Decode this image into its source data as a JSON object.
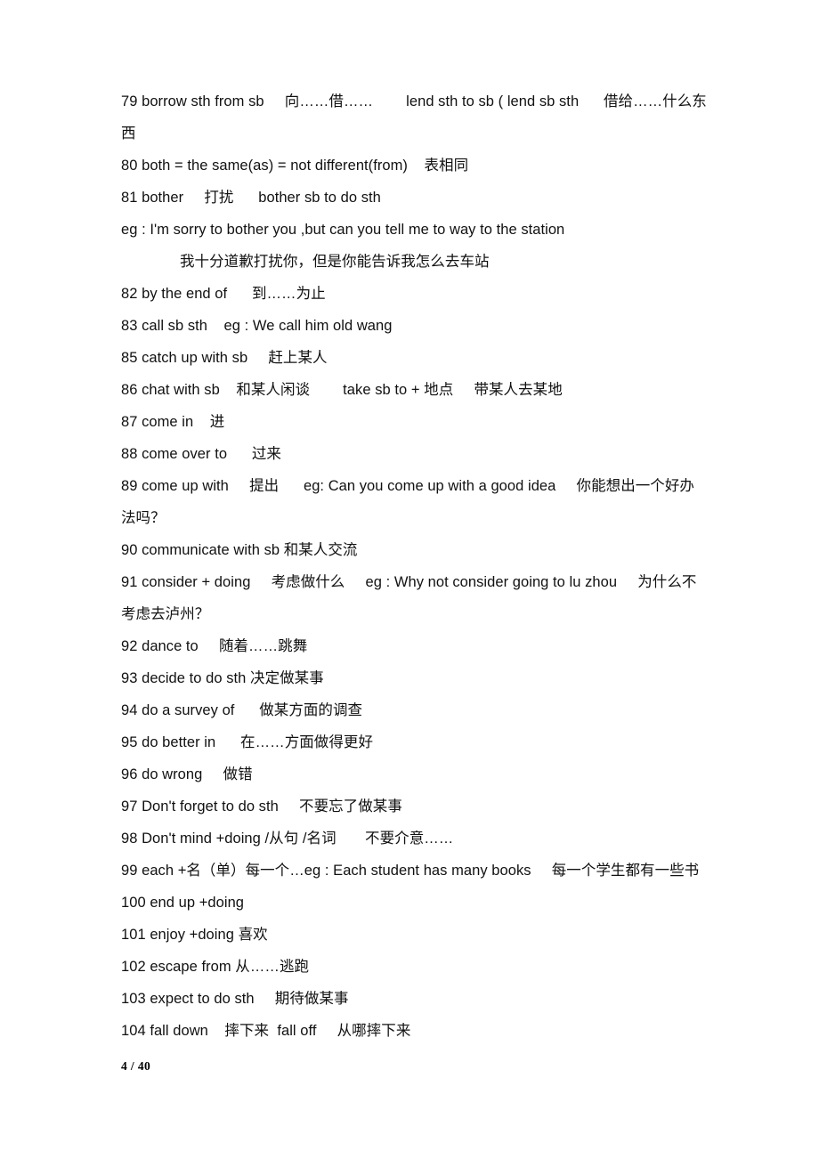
{
  "document": {
    "type": "study-notes",
    "language": "en-zh",
    "page_label": "4 / 40",
    "page_current": 4,
    "page_total": 40
  },
  "lines": [
    {
      "id": "l79",
      "number": "79",
      "text": "79 borrow sth from sb     向……借……        lend sth to sb ( lend sb sth      借给……什么东西",
      "wrap": true,
      "indent": false
    },
    {
      "id": "l80",
      "number": "80",
      "text": "80 both = the same(as) = not different(from)    表相同",
      "wrap": false,
      "indent": false
    },
    {
      "id": "l81",
      "number": "81",
      "text": "81 bother     打扰      bother sb to do sth",
      "wrap": false,
      "indent": false
    },
    {
      "id": "l81eg",
      "number": "",
      "text": "eg : I'm sorry to bother you ,but can you tell me to way to the station",
      "wrap": false,
      "indent": false
    },
    {
      "id": "l81eg-cn",
      "number": "",
      "text": "我十分道歉打扰你，但是你能告诉我怎么去车站",
      "wrap": false,
      "indent": true
    },
    {
      "id": "l82",
      "number": "82",
      "text": "82 by the end of      到……为止",
      "wrap": false,
      "indent": false
    },
    {
      "id": "l83",
      "number": "83",
      "text": "83 call sb sth    eg : We call him old wang",
      "wrap": false,
      "indent": false
    },
    {
      "id": "l85",
      "number": "85",
      "text": "85 catch up with sb     赶上某人",
      "wrap": false,
      "indent": false
    },
    {
      "id": "l86",
      "number": "86",
      "text": "86 chat with sb    和某人闲谈        take sb to + 地点     带某人去某地",
      "wrap": false,
      "indent": false
    },
    {
      "id": "l87",
      "number": "87",
      "text": "87 come in    进",
      "wrap": false,
      "indent": false
    },
    {
      "id": "l88",
      "number": "88",
      "text": "88 come over to      过来",
      "wrap": false,
      "indent": false
    },
    {
      "id": "l89",
      "number": "89",
      "text": "89 come up with     提出      eg: Can you come up with a good idea     你能想出一个好办法吗？",
      "wrap": true,
      "indent": false
    },
    {
      "id": "l90",
      "number": "90",
      "text": "90 communicate with sb 和某人交流",
      "wrap": false,
      "indent": false
    },
    {
      "id": "l91",
      "number": "91",
      "text": "91 consider + doing     考虑做什么     eg : Why not consider going to lu zhou     为什么不考虑去泸州？",
      "wrap": true,
      "indent": false
    },
    {
      "id": "l92",
      "number": "92",
      "text": "92 dance to     随着……跳舞",
      "wrap": false,
      "indent": false
    },
    {
      "id": "l93",
      "number": "93",
      "text": "93 decide to do sth 决定做某事",
      "wrap": false,
      "indent": false
    },
    {
      "id": "l94",
      "number": "94",
      "text": "94 do a survey of      做某方面的调查",
      "wrap": false,
      "indent": false
    },
    {
      "id": "l95",
      "number": "95",
      "text": "95 do better in      在……方面做得更好",
      "wrap": false,
      "indent": false
    },
    {
      "id": "l96",
      "number": "96",
      "text": "96 do wrong     做错",
      "wrap": false,
      "indent": false
    },
    {
      "id": "l97",
      "number": "97",
      "text": "97 Don't forget to do sth     不要忘了做某事",
      "wrap": false,
      "indent": false
    },
    {
      "id": "l98",
      "number": "98",
      "text": "98 Don't mind +doing /从句 /名词       不要介意……",
      "wrap": false,
      "indent": false
    },
    {
      "id": "l99",
      "number": "99",
      "text": "99 each +名（单）每一个…eg : Each student has many books     每一个学生都有一些书  100 end up +doing",
      "wrap": true,
      "indent": false
    },
    {
      "id": "l101",
      "number": "101",
      "text": "101 enjoy +doing 喜欢",
      "wrap": false,
      "indent": false
    },
    {
      "id": "l102",
      "number": "102",
      "text": "102 escape from 从……逃跑",
      "wrap": false,
      "indent": false
    },
    {
      "id": "l103",
      "number": "103",
      "text": "103 expect to do sth     期待做某事",
      "wrap": false,
      "indent": false
    },
    {
      "id": "l104",
      "number": "104",
      "text": "104 fall down    摔下来  fall off     从哪摔下来",
      "wrap": false,
      "indent": false
    }
  ]
}
